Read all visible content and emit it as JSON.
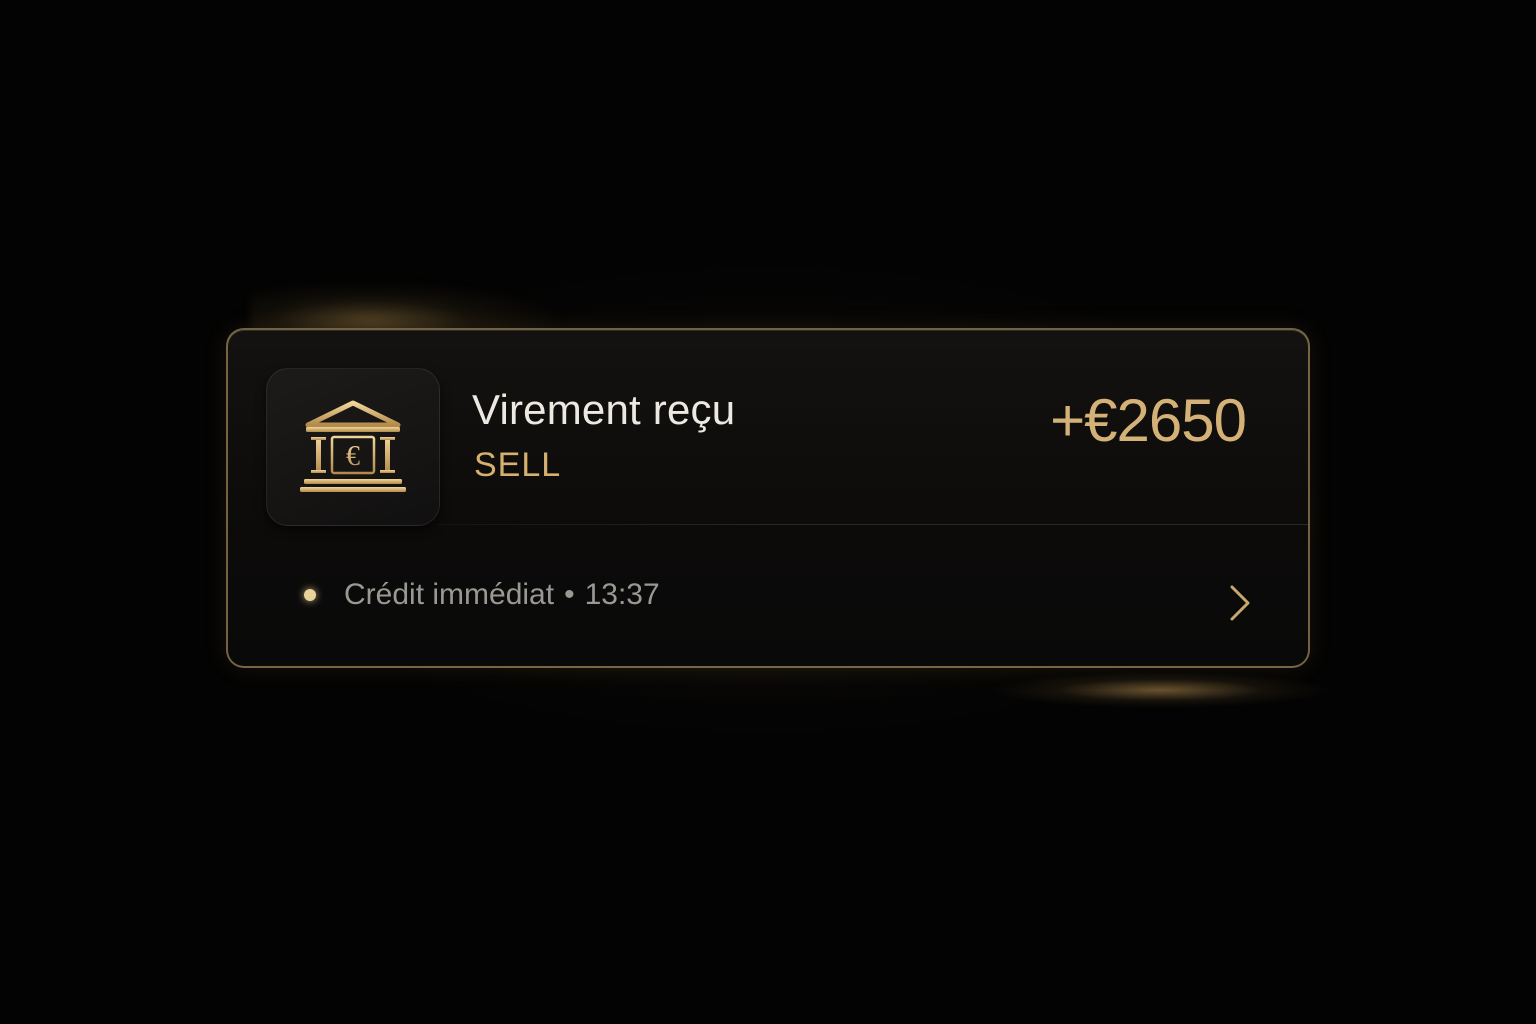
{
  "notification": {
    "title": "Virement reçu",
    "subtitle": "SELL",
    "amount": "+€2650",
    "status_text": "Crédit immédiat",
    "separator": "•",
    "time": "13:37",
    "app_icon": "bank-euro-icon",
    "chevron_icon": "chevron-right-icon"
  },
  "colors": {
    "accent_gold": "#d4b277",
    "background": "#030303",
    "text_primary": "#ece8e2",
    "text_secondary": "#9b9892"
  }
}
